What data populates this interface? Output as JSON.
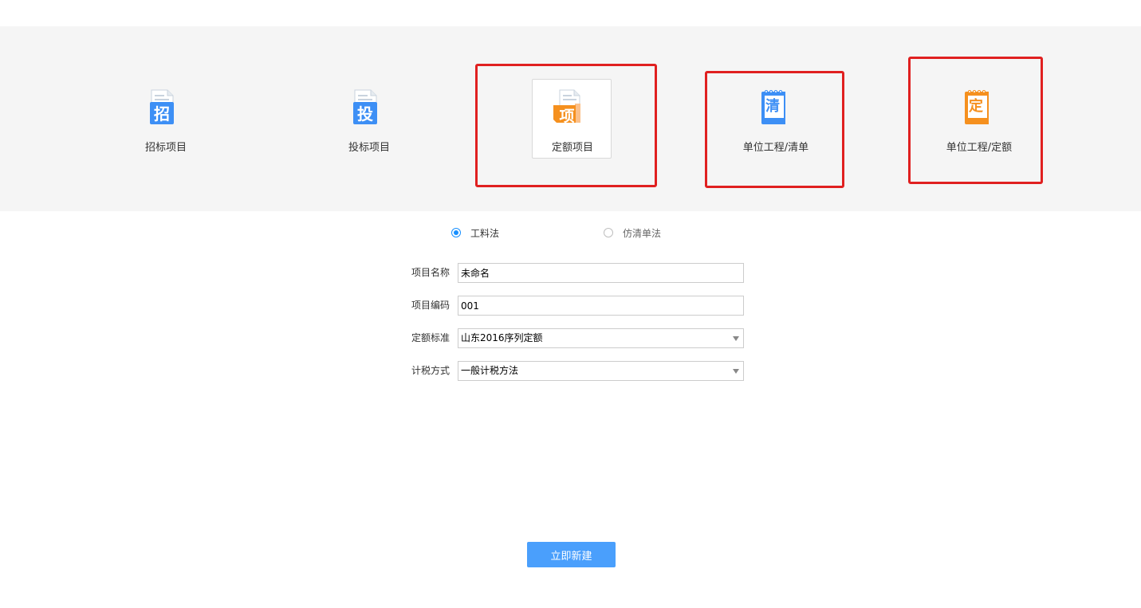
{
  "project_types": [
    {
      "label": "招标项目",
      "icon_char": "招",
      "icon": "bid-invitation-icon",
      "color": "#3d8ff5",
      "selected": false
    },
    {
      "label": "投标项目",
      "icon_char": "投",
      "icon": "bid-submission-icon",
      "color": "#3d8ff5",
      "selected": false
    },
    {
      "label": "定额项目",
      "icon_char": "项",
      "icon": "quota-project-icon",
      "color": "#f5901e",
      "selected": true
    },
    {
      "label": "单位工程/清单",
      "icon_char": "清",
      "icon": "bill-of-quantities-icon",
      "color": "#3d8ff5",
      "selected": false
    },
    {
      "label": "单位工程/定额",
      "icon_char": "定",
      "icon": "unit-quota-icon",
      "color": "#f5901e",
      "selected": false
    }
  ],
  "methods": {
    "option1": {
      "label": "工料法",
      "checked": true
    },
    "option2": {
      "label": "仿清单法",
      "checked": false
    }
  },
  "form": {
    "name": {
      "label": "项目名称",
      "value": "未命名"
    },
    "code": {
      "label": "项目编码",
      "value": "001"
    },
    "standard": {
      "label": "定额标准",
      "value": "山东2016序列定额"
    },
    "tax": {
      "label": "计税方式",
      "value": "一般计税方法"
    }
  },
  "create_button": {
    "label": "立即新建"
  },
  "colors": {
    "accent": "#4a9ffc",
    "highlight": "#e02020",
    "band": "#f5f5f5"
  }
}
